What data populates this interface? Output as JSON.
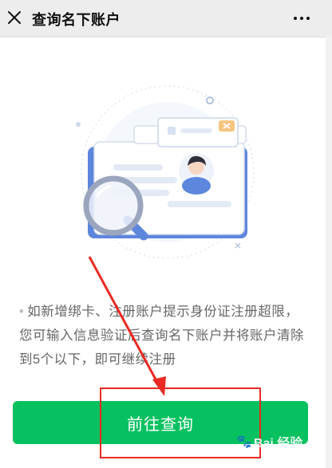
{
  "header": {
    "title": "查询名下账户",
    "close_icon": "close-icon",
    "more_icon": "more-icon"
  },
  "tip": {
    "text": "如新增绑卡、注册账户提示身份证注册超限，您可输入信息验证后查询名下账户并将账户清除到5个以下，即可继续注册"
  },
  "action": {
    "button_label": "前往查询"
  },
  "watermark": {
    "text": "Bai 经验"
  },
  "colors": {
    "primary_green": "#07c160",
    "annotation_red": "#ea2a22"
  }
}
